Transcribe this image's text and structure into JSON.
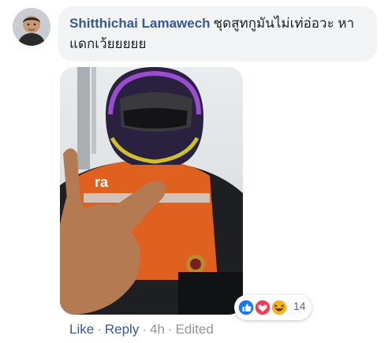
{
  "comment": {
    "author": "Shitthichai Lamawech",
    "text": "ชุดสูทกูมันไม่เท่อ่อวะ หาแดกเว้ยยยยย"
  },
  "photo": {
    "vest_text": "ra"
  },
  "reactions": {
    "count": "14",
    "icons": [
      "like-icon",
      "love-icon",
      "haha-icon"
    ]
  },
  "actions": {
    "like": "Like",
    "reply": "Reply",
    "time": "4h",
    "edited": "Edited"
  },
  "colors": {
    "link": "#385898",
    "bubble": "#f2f3f5",
    "meta": "#90949c",
    "like": "#1877f2",
    "love": "#f33e58",
    "haha": "#f7b125"
  }
}
